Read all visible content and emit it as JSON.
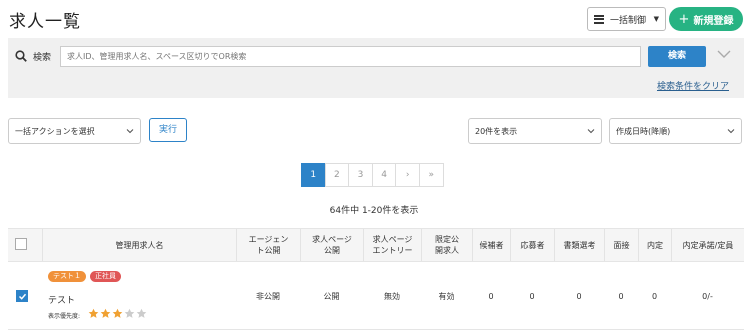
{
  "header": {
    "title": "求人一覧",
    "bulk_control_label": "一括制御",
    "new_button_label": "新規登録"
  },
  "search": {
    "label": "検索",
    "placeholder": "求人ID、管理用求人名、スペース区切りでOR検索",
    "button_label": "検索",
    "clear_label": "検索条件をクリア"
  },
  "toolbar": {
    "bulk_action_value": "一括アクションを選択",
    "execute_label": "実行",
    "per_page_value": "20件を表示",
    "sort_value": "作成日時(降順)"
  },
  "pagination": {
    "pages": [
      "1",
      "2",
      "3",
      "4",
      "›",
      "»"
    ],
    "active_page": "1"
  },
  "result_count": "64件中 1-20件を表示",
  "table": {
    "headers": [
      "管理用求人名",
      "エージェント公開",
      "求人ページ公開",
      "求人ページエントリー",
      "限定公開求人",
      "候補者",
      "応募者",
      "書類選考",
      "面接",
      "内定",
      "内定承諾/定員"
    ],
    "rows": [
      {
        "checked": true,
        "tags": [
          {
            "label": "テスト１",
            "color": "#f0913a"
          },
          {
            "label": "正社員",
            "color": "#e05656"
          }
        ],
        "name": "テスト",
        "priority_label": "表示優先度:",
        "priority_stars": 3,
        "priority_max": 5,
        "agent_public": "非公開",
        "page_public": "公開",
        "page_entry": "無効",
        "limited": "有効",
        "candidates": "0",
        "applicants": "0",
        "screening": "0",
        "interview": "0",
        "offer": "0",
        "offer_accept": "0/-"
      }
    ]
  },
  "colors": {
    "primary": "#2d83c8",
    "success": "#27b383",
    "star_on": "#f0a132",
    "star_off": "#cccccc"
  }
}
